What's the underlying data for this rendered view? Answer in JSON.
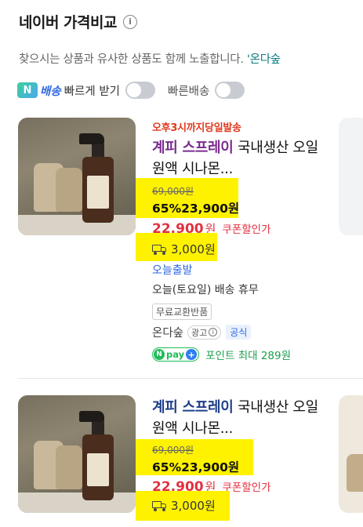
{
  "header": {
    "title": "네이버 가격비교",
    "info_icon": "i"
  },
  "subtitle": {
    "text": "찾으시는 상품과 유사한 상품도 함께 노출합니다. ",
    "highlight": "'온다숲"
  },
  "filters": {
    "n_badge": "N",
    "delivery_brand": "배송",
    "fast_label": "빠르게 받기",
    "fast_delivery_label": "빠른배송"
  },
  "products": [
    {
      "tag": "오후3시까지당일발송",
      "title_keyword": "계피 스프레이",
      "title_rest": " 국내생산 오일 원액 시나몬...",
      "original_price": "69,000원",
      "discount": "65%",
      "price": "23,900원",
      "coupon_price": "22,900",
      "coupon_won": "원",
      "coupon_label": "쿠폰할인가",
      "shipping": "3,000원",
      "today_ship": "오늘출발",
      "today_holiday": "오늘(토요일) 배송 휴무",
      "free_return": "무료교환반품",
      "seller": "온다숲",
      "ad": "광고",
      "official": "공식",
      "npay_n": "N",
      "npay_text": "pay",
      "npay_plus": "+",
      "points": "포인트 최대 289원"
    },
    {
      "title_keyword": "계피 스프레이",
      "title_rest": " 국내생산 오일 원액 시나몬...",
      "original_price": "69,000원",
      "discount": "65%",
      "price": "23,900원",
      "coupon_price": "22,900",
      "coupon_won": "원",
      "coupon_label": "쿠폰할인가",
      "shipping": "3,000원"
    }
  ]
}
